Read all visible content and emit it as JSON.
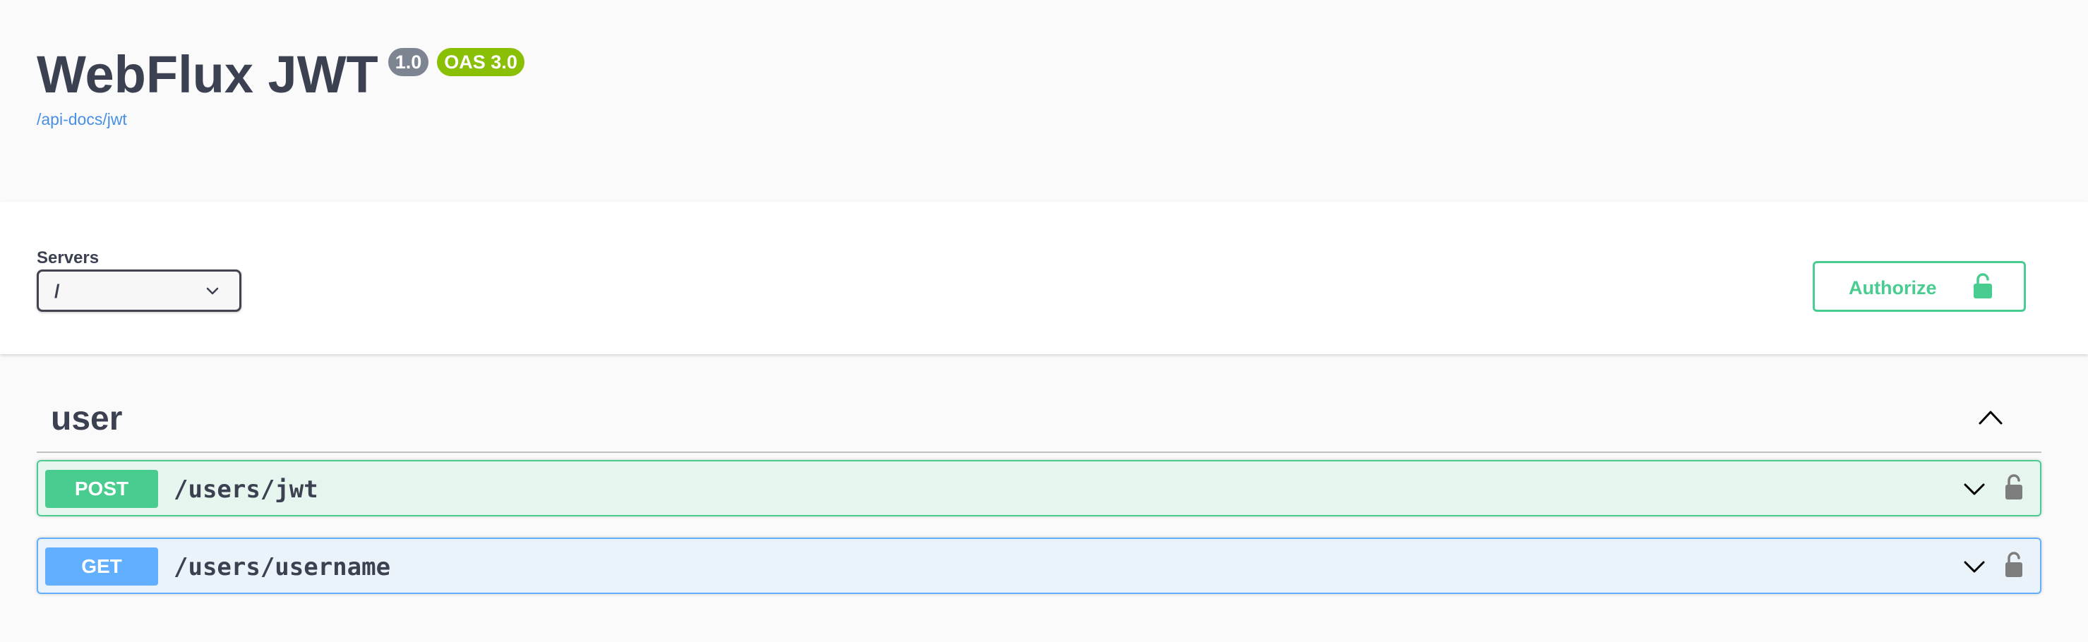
{
  "info": {
    "title": "WebFlux JWT",
    "version": "1.0",
    "oas": "OAS 3.0",
    "spec_link": "/api-docs/jwt"
  },
  "servers": {
    "label": "Servers",
    "selected": "/"
  },
  "authorize": {
    "label": "Authorize"
  },
  "tag": {
    "name": "user"
  },
  "operations": [
    {
      "method": "POST",
      "path": "/users/jwt",
      "color": "#49cc90"
    },
    {
      "method": "GET",
      "path": "/users/username",
      "color": "#61affe"
    }
  ],
  "colors": {
    "post": "#49cc90",
    "get": "#61affe",
    "version_badge": "#7d8492",
    "oas_badge": "#89bf04",
    "link": "#4990e2",
    "text": "#3b4151"
  },
  "icons": {
    "server_dropdown": "chevron-down-icon",
    "authorize": "unlocked-lock-icon",
    "tag_toggle": "chevron-up-icon",
    "op_expand": "chevron-down-icon",
    "op_lock": "lock-icon"
  }
}
